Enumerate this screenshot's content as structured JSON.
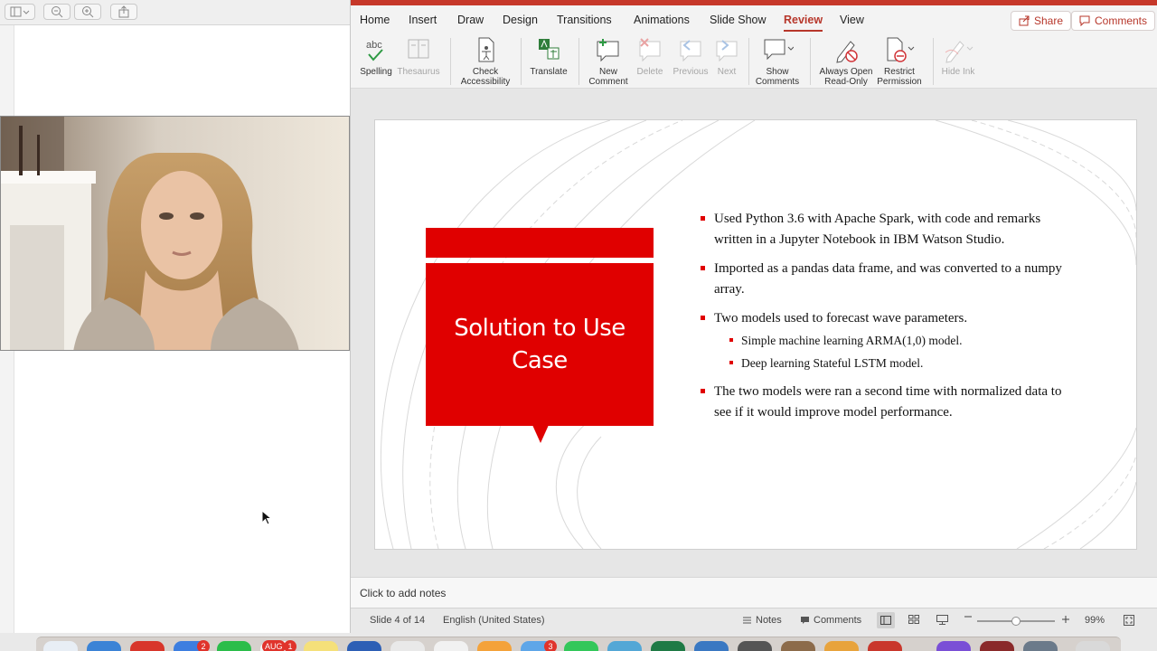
{
  "ribbon_tabs": [
    "Home",
    "Insert",
    "Draw",
    "Design",
    "Transitions",
    "Animations",
    "Slide Show",
    "Review",
    "View"
  ],
  "active_tab": "Review",
  "top_buttons": {
    "share": "Share",
    "comments": "Comments"
  },
  "ribbon_buttons": {
    "spelling": "Spelling",
    "thesaurus": "Thesaurus",
    "check_accessibility": [
      "Check",
      "Accessibility"
    ],
    "translate": "Translate",
    "new_comment": [
      "New",
      "Comment"
    ],
    "delete": "Delete",
    "previous": "Previous",
    "next": "Next",
    "show_comments": [
      "Show",
      "Comments"
    ],
    "always_open_read_only": [
      "Always Open",
      "Read-Only"
    ],
    "restrict_permission": [
      "Restrict",
      "Permission"
    ],
    "hide_ink": "Hide Ink",
    "spelling_icon_text": "abc"
  },
  "slide": {
    "title": "Solution to Use Case",
    "title_lines": [
      "Solution to Use",
      "Case"
    ],
    "bullets": [
      {
        "text": "Used Python 3.6 with Apache Spark, with code and remarks written in a Jupyter Notebook in IBM Watson Studio."
      },
      {
        "text": "Imported as a pandas data frame, and was converted to a numpy array."
      },
      {
        "text": "Two models used to forecast wave parameters."
      },
      {
        "text": "The two models were ran a second time with normalized data to see if it would improve model performance."
      }
    ],
    "sub_bullets": [
      "Simple machine learning ARMA(1,0) model.",
      "Deep learning Stateful LSTM model."
    ]
  },
  "notes_placeholder": "Click to add notes",
  "status": {
    "slide_counter": "Slide 4 of 14",
    "language": "English (United States)",
    "notes": "Notes",
    "comments": "Comments",
    "zoom": "99%",
    "zoom_level": 0.99
  },
  "dock_badges": [
    "2",
    "AUG",
    "1",
    "3"
  ],
  "colors": {
    "accent": "#b7372b",
    "slide_red": "#e00000",
    "titlebar": "#c6382a"
  }
}
